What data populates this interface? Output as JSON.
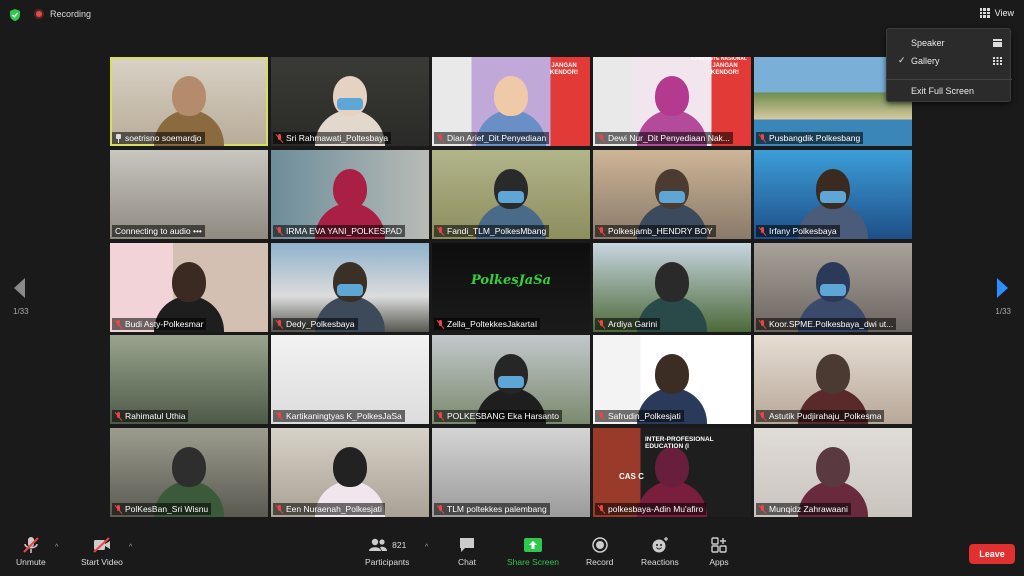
{
  "topbar": {
    "recording_label": "Recording",
    "view_label": "View"
  },
  "view_menu": {
    "items": [
      {
        "label": "Speaker",
        "checked": false,
        "icon": "speaker-layout-icon"
      },
      {
        "label": "Gallery",
        "checked": true,
        "icon": "gallery-grid-icon"
      },
      {
        "label": "Exit Full Screen",
        "checked": false,
        "icon": ""
      }
    ]
  },
  "gallery": {
    "page_left": "1/33",
    "page_right": "1/33",
    "tiles": [
      {
        "name": "soetrisno soemardjo",
        "muted": false,
        "pinned": true,
        "active": true
      },
      {
        "name": "Sri Rahmawati_Poltesbaya",
        "muted": true
      },
      {
        "name": "Dian Arief_Dit.Penyediaan",
        "muted": true
      },
      {
        "name": "Dewi Nur_Dit Penyediaan Nak...",
        "muted": true
      },
      {
        "name": "Pusbangdik Polkesbang",
        "muted": true
      },
      {
        "name": "Connecting to audio •••",
        "muted": false
      },
      {
        "name": "IRMA EVA YANI_POLKESPAD",
        "muted": true
      },
      {
        "name": "Fandi_TLM_PolkesMbang",
        "muted": true
      },
      {
        "name": "Polkesjamb_HENDRY BOY",
        "muted": true
      },
      {
        "name": "Irfany Polkesbaya",
        "muted": true
      },
      {
        "name": "Budi Asty-Polkesmar",
        "muted": true
      },
      {
        "name": "Dedy_Polkesbaya",
        "muted": true
      },
      {
        "name": "Zella_PoltekkesJakartaI",
        "muted": true
      },
      {
        "name": "Ardiya Garini",
        "muted": true
      },
      {
        "name": "Koor.SPME.Polkesbaya_dwi ut...",
        "muted": true
      },
      {
        "name": "Rahimatul Uthia",
        "muted": true
      },
      {
        "name": "Kartikaningtyas K_PolkesJaSa",
        "muted": true
      },
      {
        "name": "POLKESBANG Eka Harsanto",
        "muted": true
      },
      {
        "name": "Safrudin_Polkesjati",
        "muted": true
      },
      {
        "name": "Astutik Pudjirahaju_Polkesma",
        "muted": true
      },
      {
        "name": "PolKesBan_Sri Wisnu",
        "muted": true
      },
      {
        "name": "Een Nuraenah_Polkesjati",
        "muted": true
      },
      {
        "name": "TLM poltekkes palembang",
        "muted": true
      },
      {
        "name": "polkesbaya-Adin Mu'afiro",
        "muted": true
      },
      {
        "name": "Munqidz Zahrawaani",
        "muted": true
      }
    ],
    "overlay_texts": {
      "banner_jangan": "JANGAN KENDOR!",
      "banner_kampanye": "KAMPANYE NASIONAL",
      "polkesjasa_logo": "PolkesJaSa",
      "ipe_title": "INTER-PROFESIONAL EDUCATION (I",
      "ipe_sub": "CAS C"
    }
  },
  "toolbar": {
    "unmute": "Unmute",
    "start_video": "Start Video",
    "participants": "Participants",
    "participants_count": "821",
    "chat": "Chat",
    "share_screen": "Share Screen",
    "record": "Record",
    "reactions": "Reactions",
    "apps": "Apps",
    "leave": "Leave"
  },
  "colors": {
    "active_speaker_border": "#d6e05a",
    "share_green": "#2ec84d",
    "leave_red": "#e0302f",
    "next_arrow_blue": "#2d8cff"
  }
}
